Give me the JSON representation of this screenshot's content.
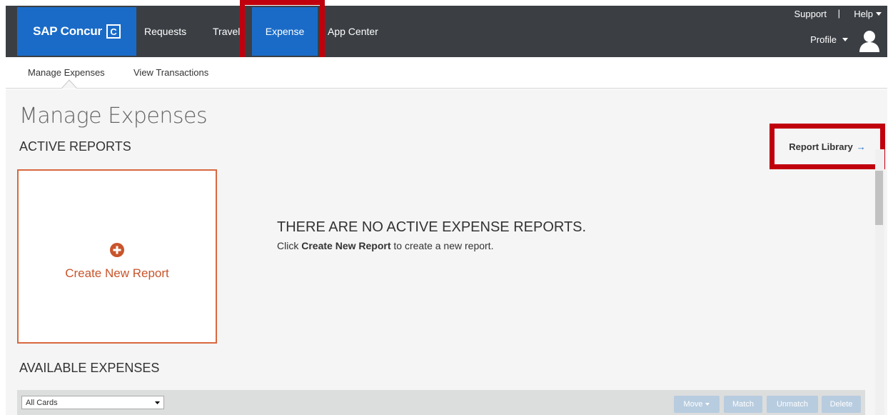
{
  "header": {
    "brand": "SAP Concur",
    "brand_mark": "C",
    "nav": [
      "Requests",
      "Travel",
      "Expense",
      "App Center"
    ],
    "support": "Support",
    "separator": "|",
    "help": "Help",
    "profile": "Profile"
  },
  "subnav": {
    "items": [
      "Manage Expenses",
      "View Transactions"
    ]
  },
  "main": {
    "title": "Manage Expenses",
    "active_reports": "ACTIVE REPORTS",
    "report_library": "Report Library",
    "report_library_arrow": "→",
    "create_new_report": "Create New Report",
    "empty_title": "THERE ARE NO ACTIVE EXPENSE REPORTS.",
    "empty_prefix": "Click",
    "empty_bold": "Create New Report",
    "empty_suffix": "to create a new report.",
    "available_expenses": "AVAILABLE EXPENSES"
  },
  "toolbar": {
    "select_value": "All Cards",
    "move": "Move",
    "match": "Match",
    "unmatch": "Unmatch",
    "delete": "Delete"
  },
  "colors": {
    "topbar": "#3b3f44",
    "brand_blue": "#1a6bc7",
    "highlight_red": "#c0000d",
    "create_orange": "#d9683f"
  },
  "icons": {
    "avatar": "user-avatar-icon",
    "plus": "plus-circle-icon",
    "caret": "caret-down-icon",
    "arrow": "arrow-right-icon"
  }
}
